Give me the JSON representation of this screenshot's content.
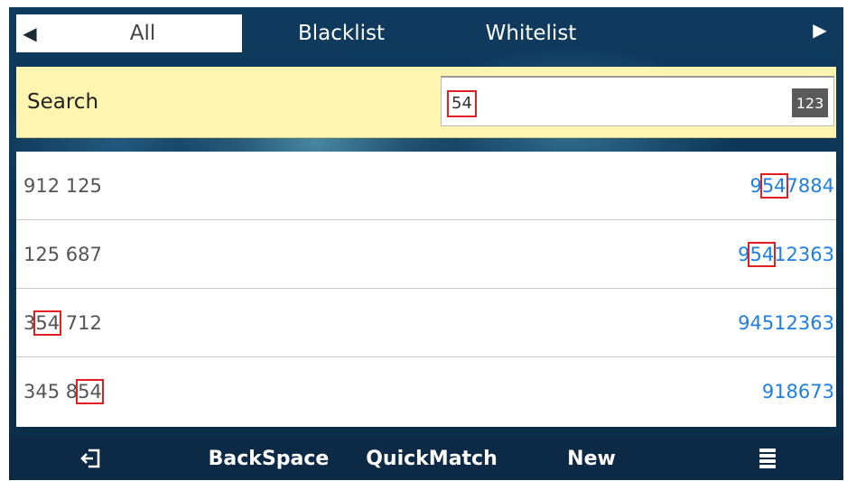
{
  "tabs": {
    "items": [
      {
        "label": "All"
      },
      {
        "label": "Blacklist"
      },
      {
        "label": "Whitelist"
      }
    ],
    "active_index": 0,
    "left_arrow_icon": "arrow-left-icon",
    "right_arrow_icon": "arrow-right-icon"
  },
  "search": {
    "label": "Search",
    "value": "54",
    "input_mode": "123"
  },
  "contacts": [
    {
      "name_pre": "912 125",
      "name_hl": "",
      "name_post": "",
      "num_pre": "9",
      "num_hl": "54",
      "num_post": "7884"
    },
    {
      "name_pre": "125 687",
      "name_hl": "",
      "name_post": "",
      "num_pre": "9",
      "num_hl": "54",
      "num_post": "12363"
    },
    {
      "name_pre": "3",
      "name_hl": "54",
      "name_post": " 712",
      "num_pre": "94512363",
      "num_hl": "",
      "num_post": ""
    },
    {
      "name_pre": "345 8",
      "name_hl": "54",
      "name_post": "",
      "num_pre": "918673",
      "num_hl": "",
      "num_post": ""
    }
  ],
  "softkeys": {
    "back_icon": "exit-icon",
    "backspace": "BackSpace",
    "quickmatch": "QuickMatch",
    "new": "New",
    "menu_icon": "menu-icon"
  },
  "colors": {
    "highlight_border": "#e02020",
    "number_text": "#1f7fe0",
    "search_bg": "#fdf5b0",
    "bar_bg": "#0c2a45"
  }
}
